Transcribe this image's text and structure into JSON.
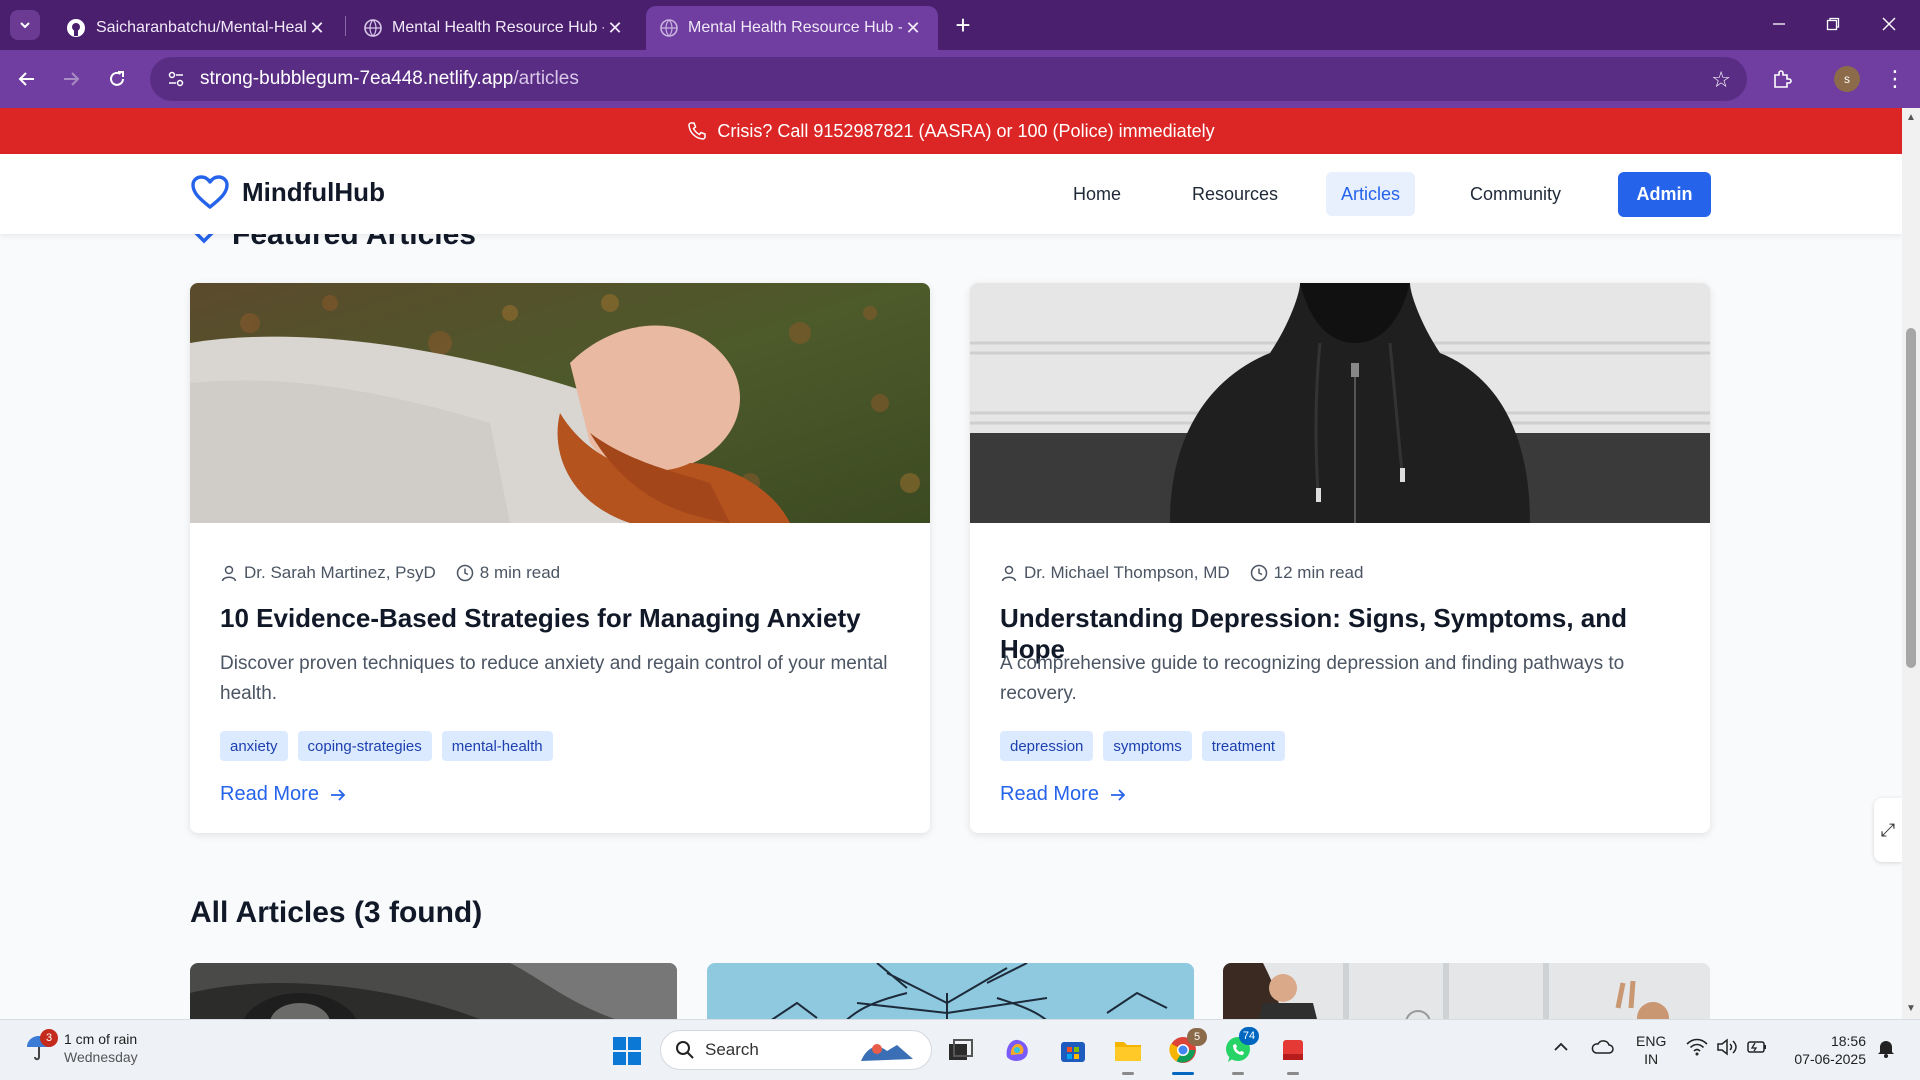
{
  "browser": {
    "tabs": [
      {
        "title": "Saicharanbatchu/Mental-Health-Resource-Hub",
        "active": false,
        "icon": "github-icon"
      },
      {
        "title": "Mental Health Resource Hub - Support",
        "active": false,
        "icon": "globe-icon"
      },
      {
        "title": "Mental Health Resource Hub - Support",
        "active": true,
        "icon": "globe-icon"
      }
    ],
    "url_host": "strong-bubblegum-7ea448.netlify.app",
    "url_path": "/articles",
    "profile_initial": "s"
  },
  "crisis_banner": "Crisis? Call 9152987821 (AASRA) or 100 (Police) immediately",
  "site": {
    "logo_text": "MindfulHub",
    "nav": [
      {
        "label": "Home",
        "active": false
      },
      {
        "label": "Resources",
        "active": false
      },
      {
        "label": "Articles",
        "active": true
      },
      {
        "label": "Community",
        "active": false
      }
    ],
    "admin_label": "Admin"
  },
  "featured_heading": "Featured Articles",
  "featured_articles": [
    {
      "author": "Dr. Sarah Martinez, PsyD",
      "read_time": "8 min read",
      "title": "10 Evidence-Based Strategies for Managing Anxiety",
      "description": "Discover proven techniques to reduce anxiety and regain control of your mental health.",
      "tags": [
        "anxiety",
        "coping-strategies",
        "mental-health"
      ],
      "read_more": "Read More"
    },
    {
      "author": "Dr. Michael Thompson, MD",
      "read_time": "12 min read",
      "title": "Understanding Depression: Signs, Symptoms, and Hope",
      "description": "A comprehensive guide to recognizing depression and finding pathways to recovery.",
      "tags": [
        "depression",
        "symptoms",
        "treatment"
      ],
      "read_more": "Read More"
    }
  ],
  "all_articles_heading": "All Articles (3 found)",
  "taskbar": {
    "weather_badge": "3",
    "weather_line1": "1 cm of rain",
    "weather_line2": "Wednesday",
    "search_label": "Search",
    "chrome_badge": "5",
    "whatsapp_badge": "74",
    "lang_line1": "ENG",
    "lang_line2": "IN",
    "time": "18:56",
    "date": "07-06-2025"
  },
  "colors": {
    "accent": "#2563eb",
    "crisis": "#dc2626",
    "browser_frame": "#6f3ea0"
  }
}
